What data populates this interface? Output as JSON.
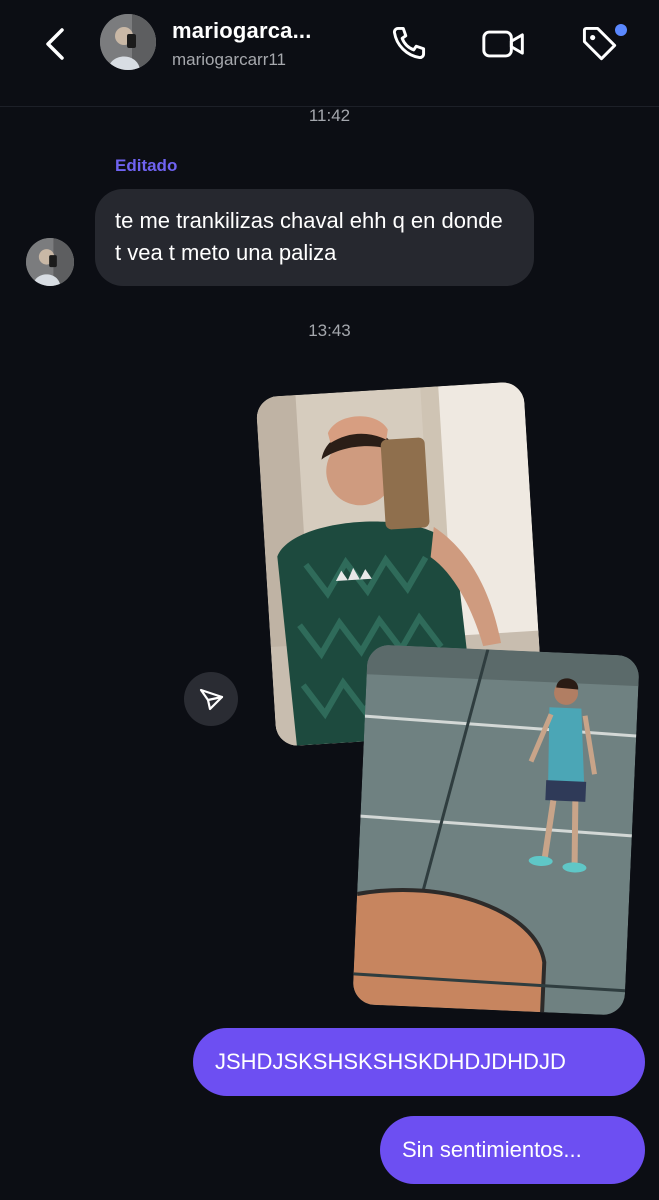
{
  "header": {
    "title": "mariogarca...",
    "subtitle": "mariogarcarr11",
    "icons": {
      "back": "chevron-left-icon",
      "call": "phone-icon",
      "video": "video-camera-icon",
      "tag": "tag-icon"
    },
    "accent_dot_color": "#5a88ff"
  },
  "messages": {
    "timestamp_1": "11:42",
    "edited_label": "Editado",
    "incoming_text": "te me trankilizas chaval ehh q en donde t vea t meto una paliza",
    "timestamp_2": "13:43",
    "outgoing_1": "JSHDJSKSHSKSHSKDHDJDHDJD",
    "outgoing_2": "Sin sentimientos...",
    "share_icon": "send-icon"
  },
  "colors": {
    "background": "#0c0e14",
    "incoming_bubble": "#26282f",
    "outgoing_bubble": "#6d4ff2",
    "edited_label": "#6f63f1"
  }
}
